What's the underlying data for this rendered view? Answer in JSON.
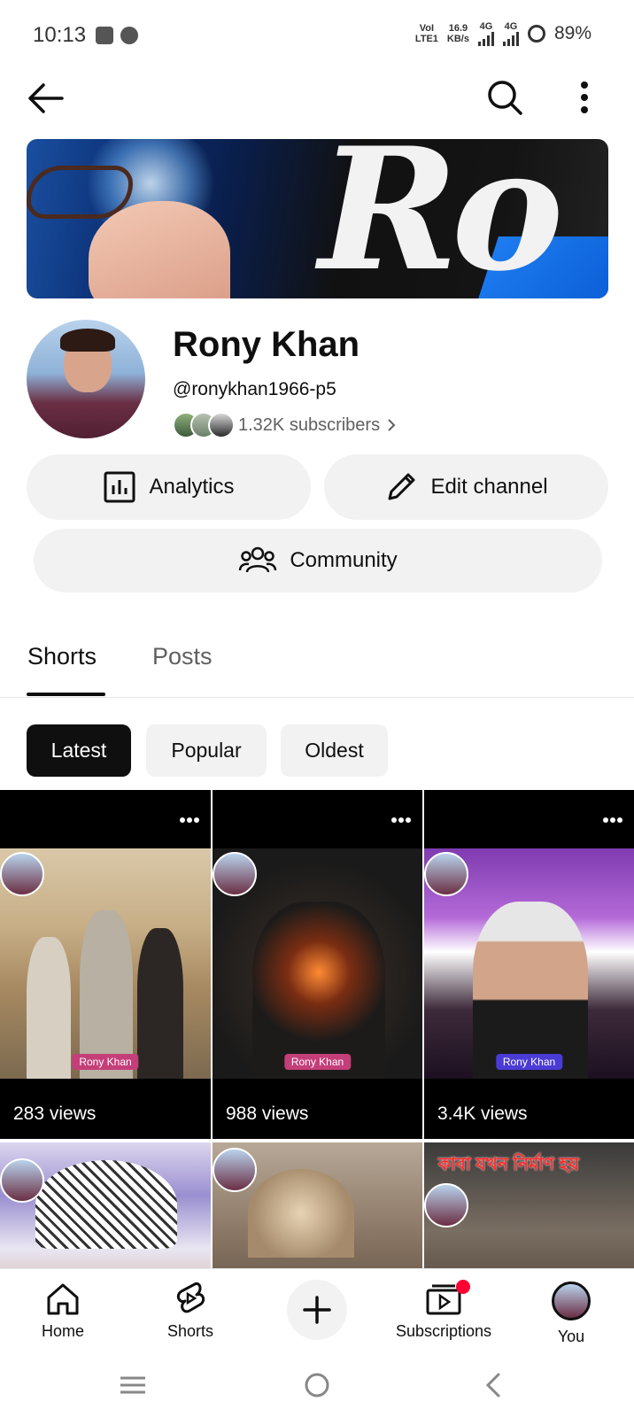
{
  "status_bar": {
    "time": "10:13",
    "net_top": "VoI",
    "net_bottom": "LTE1",
    "speed_value": "16.9",
    "speed_unit": "KB/s",
    "signal1_label": "4G",
    "signal2_label": "4G",
    "battery": "89%"
  },
  "top_nav": {
    "back_icon": "arrow-left-icon",
    "search_icon": "search-icon",
    "more_icon": "more-vertical-icon"
  },
  "channel": {
    "name": "Rony Khan",
    "handle": "@ronykhan1966-p5",
    "subscribers": "1.32K subscribers"
  },
  "actions": {
    "analytics_label": "Analytics",
    "edit_label": "Edit channel",
    "community_label": "Community"
  },
  "tabs": [
    {
      "label": "Shorts",
      "active": true
    },
    {
      "label": "Posts",
      "active": false
    }
  ],
  "filters": [
    {
      "label": "Latest",
      "selected": true
    },
    {
      "label": "Popular",
      "selected": false
    },
    {
      "label": "Oldest",
      "selected": false
    }
  ],
  "shorts": [
    {
      "views": "283 views",
      "brand": "Rony Khan"
    },
    {
      "views": "988 views",
      "brand": "Rony Khan"
    },
    {
      "views": "3.4K views",
      "brand": "Rony Khan"
    },
    {
      "views": "",
      "overlay_text": ""
    },
    {
      "views": "",
      "overlay_text": ""
    },
    {
      "views": "",
      "overlay_text": "কাবা যখন নির্মাণ হয়"
    }
  ],
  "bottom_nav": [
    {
      "label": "Home",
      "icon": "home-icon"
    },
    {
      "label": "Shorts",
      "icon": "shorts-icon"
    },
    {
      "label": "",
      "icon": "create-plus-icon"
    },
    {
      "label": "Subscriptions",
      "icon": "subscriptions-icon"
    },
    {
      "label": "You",
      "icon": "avatar"
    }
  ],
  "colors": {
    "accent": "#0f0f0f",
    "chip_bg": "#f2f2f2",
    "notification_dot": "#ff0033",
    "secondary_text": "#606060"
  }
}
